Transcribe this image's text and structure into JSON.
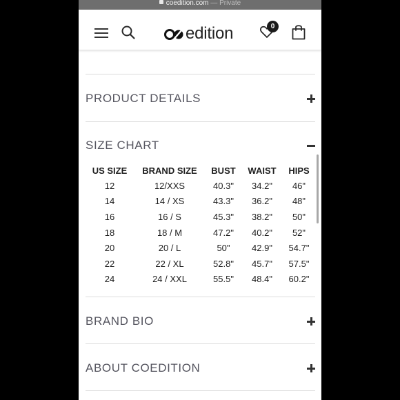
{
  "browser": {
    "url": "coedition.com",
    "separator": "—",
    "mode": "Private"
  },
  "header": {
    "logo_text": "edition",
    "wishlist_count": "0",
    "icons": [
      "menu-icon",
      "search-icon",
      "heart-icon",
      "shopping-bag-icon"
    ]
  },
  "sections": {
    "product_details": "PRODUCT DETAILS",
    "size_chart": "SIZE CHART",
    "brand_bio": "BRAND BIO",
    "about": "ABOUT COEDITION"
  },
  "size_chart": {
    "headers": [
      "US SIZE",
      "BRAND SIZE",
      "BUST",
      "WAIST",
      "HIPS"
    ],
    "rows": [
      [
        "12",
        "12/XXS",
        "40.3\"",
        "34.2\"",
        "46\""
      ],
      [
        "14",
        "14 / XS",
        "43.3\"",
        "36.2\"",
        "48\""
      ],
      [
        "16",
        "16 / S",
        "45.3\"",
        "38.2\"",
        "50\""
      ],
      [
        "18",
        "18 / M",
        "47.2\"",
        "40.2\"",
        "52\""
      ],
      [
        "20",
        "20 / L",
        "50\"",
        "42.9\"",
        "54.7\""
      ],
      [
        "22",
        "22 / XL",
        "52.8\"",
        "45.7\"",
        "57.5\""
      ],
      [
        "24",
        "24 / XXL",
        "55.5\"",
        "48.4\"",
        "60.2\""
      ]
    ]
  },
  "colors": {
    "section_title": "#55555f",
    "text": "#1e1e1e",
    "divider": "#dcdcdc"
  }
}
